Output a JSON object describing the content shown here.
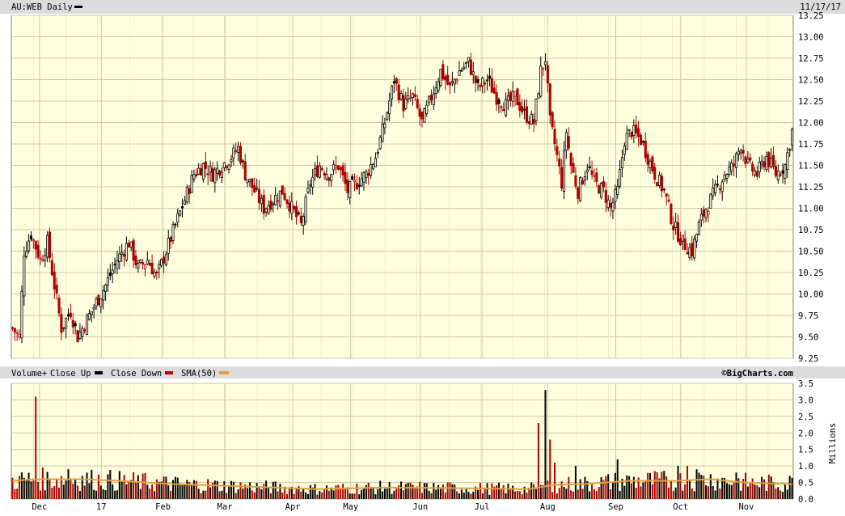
{
  "header": {
    "symbol_label": "AU:WEB Daily",
    "date_label": "11/17/17"
  },
  "volume_header": {
    "title": "Volume+",
    "close_up_label": "Close Up",
    "close_down_label": "Close Down",
    "sma_label": "SMA(50)",
    "credit": "©BigCharts.com"
  },
  "colors": {
    "plot_bg": "#ffffe0",
    "grid": "#c8c8a0",
    "up": "#000000",
    "down": "#b00000",
    "sma": "#e0a040",
    "header_bg": "#dcdcdc"
  },
  "chart_data": [
    {
      "type": "candlestick",
      "title": "AU:WEB Daily",
      "ylim": [
        9.25,
        13.25
      ],
      "y_ticks": [
        "9.25",
        "9.50",
        "9.75",
        "10.00",
        "10.25",
        "10.50",
        "10.75",
        "11.00",
        "11.25",
        "11.50",
        "11.75",
        "12.00",
        "12.25",
        "12.50",
        "12.75",
        "13.00",
        "13.25"
      ],
      "x_labels": [
        "Dec",
        "17",
        "Feb",
        "Mar",
        "Apr",
        "May",
        "Jun",
        "Jul",
        "Aug",
        "Sep",
        "Oct",
        "Nov"
      ],
      "grid": true,
      "close_path": [
        {
          "x": 0,
          "y": 9.6
        },
        {
          "x": 3,
          "y": 9.5
        },
        {
          "x": 5,
          "y": 10.5
        },
        {
          "x": 8,
          "y": 10.7
        },
        {
          "x": 12,
          "y": 10.4
        },
        {
          "x": 15,
          "y": 10.6
        },
        {
          "x": 18,
          "y": 10.1
        },
        {
          "x": 21,
          "y": 9.6
        },
        {
          "x": 25,
          "y": 9.8
        },
        {
          "x": 28,
          "y": 9.5
        },
        {
          "x": 32,
          "y": 9.7
        },
        {
          "x": 36,
          "y": 9.9
        },
        {
          "x": 40,
          "y": 10.1
        },
        {
          "x": 45,
          "y": 10.4
        },
        {
          "x": 50,
          "y": 10.6
        },
        {
          "x": 54,
          "y": 10.3
        },
        {
          "x": 58,
          "y": 10.4
        },
        {
          "x": 62,
          "y": 10.2
        },
        {
          "x": 66,
          "y": 10.5
        },
        {
          "x": 70,
          "y": 10.8
        },
        {
          "x": 74,
          "y": 11.1
        },
        {
          "x": 78,
          "y": 11.4
        },
        {
          "x": 82,
          "y": 11.5
        },
        {
          "x": 86,
          "y": 11.4
        },
        {
          "x": 90,
          "y": 11.5
        },
        {
          "x": 94,
          "y": 11.6
        },
        {
          "x": 97,
          "y": 11.7
        },
        {
          "x": 100,
          "y": 11.4
        },
        {
          "x": 104,
          "y": 11.2
        },
        {
          "x": 108,
          "y": 11.0
        },
        {
          "x": 112,
          "y": 11.1
        },
        {
          "x": 116,
          "y": 11.2
        },
        {
          "x": 120,
          "y": 11.0
        },
        {
          "x": 124,
          "y": 10.8
        },
        {
          "x": 128,
          "y": 11.3
        },
        {
          "x": 132,
          "y": 11.5
        },
        {
          "x": 136,
          "y": 11.4
        },
        {
          "x": 140,
          "y": 11.5
        },
        {
          "x": 144,
          "y": 11.2
        },
        {
          "x": 148,
          "y": 11.3
        },
        {
          "x": 152,
          "y": 11.4
        },
        {
          "x": 156,
          "y": 11.6
        },
        {
          "x": 160,
          "y": 12.0
        },
        {
          "x": 164,
          "y": 12.5
        },
        {
          "x": 168,
          "y": 12.2
        },
        {
          "x": 172,
          "y": 12.3
        },
        {
          "x": 176,
          "y": 12.0
        },
        {
          "x": 180,
          "y": 12.3
        },
        {
          "x": 184,
          "y": 12.6
        },
        {
          "x": 188,
          "y": 12.4
        },
        {
          "x": 192,
          "y": 12.6
        },
        {
          "x": 196,
          "y": 12.7
        },
        {
          "x": 200,
          "y": 12.4
        },
        {
          "x": 204,
          "y": 12.5
        },
        {
          "x": 208,
          "y": 12.3
        },
        {
          "x": 212,
          "y": 12.2
        },
        {
          "x": 216,
          "y": 12.3
        },
        {
          "x": 220,
          "y": 12.1
        },
        {
          "x": 224,
          "y": 12.0
        },
        {
          "x": 227,
          "y": 12.6
        },
        {
          "x": 229,
          "y": 12.75
        },
        {
          "x": 231,
          "y": 12.0
        },
        {
          "x": 233,
          "y": 11.75
        },
        {
          "x": 236,
          "y": 11.3
        },
        {
          "x": 238,
          "y": 11.9
        },
        {
          "x": 240,
          "y": 11.5
        },
        {
          "x": 243,
          "y": 11.2
        },
        {
          "x": 247,
          "y": 11.5
        },
        {
          "x": 250,
          "y": 11.3
        },
        {
          "x": 254,
          "y": 11.2
        },
        {
          "x": 257,
          "y": 11.0
        },
        {
          "x": 260,
          "y": 11.2
        },
        {
          "x": 263,
          "y": 11.8
        },
        {
          "x": 266,
          "y": 11.9
        },
        {
          "x": 270,
          "y": 11.8
        },
        {
          "x": 273,
          "y": 11.6
        },
        {
          "x": 276,
          "y": 11.4
        },
        {
          "x": 280,
          "y": 11.2
        },
        {
          "x": 284,
          "y": 10.8
        },
        {
          "x": 288,
          "y": 10.6
        },
        {
          "x": 292,
          "y": 10.5
        },
        {
          "x": 295,
          "y": 10.8
        },
        {
          "x": 298,
          "y": 11.0
        },
        {
          "x": 302,
          "y": 11.2
        },
        {
          "x": 306,
          "y": 11.4
        },
        {
          "x": 310,
          "y": 11.5
        },
        {
          "x": 313,
          "y": 11.75
        },
        {
          "x": 316,
          "y": 11.5
        },
        {
          "x": 320,
          "y": 11.4
        },
        {
          "x": 324,
          "y": 11.6
        },
        {
          "x": 328,
          "y": 11.4
        },
        {
          "x": 332,
          "y": 11.5
        },
        {
          "x": 335,
          "y": 11.9
        }
      ]
    },
    {
      "type": "bar",
      "title": "Volume+",
      "ylabel": "Millions",
      "ylim": [
        0,
        3.5
      ],
      "y_ticks": [
        "0.0",
        "0.5",
        "1.0",
        "1.5",
        "2.0",
        "2.5",
        "3.0",
        "3.5"
      ],
      "spikes": [
        {
          "x": 10,
          "y": 3.1,
          "dir": "down"
        },
        {
          "x": 24,
          "y": 0.9,
          "dir": "up"
        },
        {
          "x": 226,
          "y": 2.3,
          "dir": "down"
        },
        {
          "x": 229,
          "y": 3.3,
          "dir": "up"
        },
        {
          "x": 231,
          "y": 1.8,
          "dir": "down"
        },
        {
          "x": 233,
          "y": 1.1,
          "dir": "down"
        },
        {
          "x": 242,
          "y": 1.0,
          "dir": "up"
        },
        {
          "x": 260,
          "y": 1.2,
          "dir": "up"
        },
        {
          "x": 286,
          "y": 1.0,
          "dir": "up"
        },
        {
          "x": 290,
          "y": 1.0,
          "dir": "down"
        },
        {
          "x": 294,
          "y": 0.9,
          "dir": "up"
        },
        {
          "x": 311,
          "y": 0.8,
          "dir": "up"
        },
        {
          "x": 334,
          "y": 0.7,
          "dir": "up"
        }
      ],
      "sma_path": [
        {
          "x": 0,
          "y": 0.55
        },
        {
          "x": 10,
          "y": 0.6
        },
        {
          "x": 30,
          "y": 0.6
        },
        {
          "x": 45,
          "y": 0.55
        },
        {
          "x": 70,
          "y": 0.45
        },
        {
          "x": 100,
          "y": 0.38
        },
        {
          "x": 130,
          "y": 0.3
        },
        {
          "x": 160,
          "y": 0.35
        },
        {
          "x": 200,
          "y": 0.32
        },
        {
          "x": 222,
          "y": 0.3
        },
        {
          "x": 232,
          "y": 0.42
        },
        {
          "x": 245,
          "y": 0.45
        },
        {
          "x": 265,
          "y": 0.55
        },
        {
          "x": 285,
          "y": 0.55
        },
        {
          "x": 300,
          "y": 0.6
        },
        {
          "x": 315,
          "y": 0.5
        },
        {
          "x": 335,
          "y": 0.45
        }
      ]
    }
  ]
}
